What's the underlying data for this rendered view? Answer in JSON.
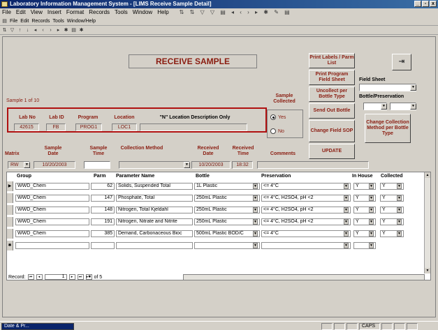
{
  "window": {
    "title": "Laboratory Information Management System - [LIMS Receive Sample Detail]",
    "min": "_",
    "max": "▫",
    "close": "x"
  },
  "menu": [
    "File",
    "Edit",
    "View",
    "Insert",
    "Format",
    "Records",
    "Tools",
    "Window",
    "Help"
  ],
  "menu2": [
    "File",
    "Edit",
    "Records",
    "Tools",
    "Window/Help"
  ],
  "form": {
    "title": "RECEIVE SAMPLE",
    "sample_count": "Sample 1 of 10",
    "labels": {
      "lab_no": "Lab No",
      "lab_id": "Lab ID",
      "program": "Program",
      "location": "Location",
      "loc_desc": "\"N\" Location Description Only",
      "sample_collected": "Sample Collected",
      "yes": "Yes",
      "no": "No",
      "matrix": "Matrix",
      "sample_date": "Sample Date",
      "sample_time": "Sample Time",
      "collection_method": "Collection Method",
      "received_date": "Received Date",
      "received_time": "Received Time",
      "comments": "Comments",
      "field_sheet": "Field Sheet",
      "bottle_pres": "Bottle/Preservation"
    },
    "values": {
      "lab_no": "42615",
      "lab_id": "FB",
      "program": "PROG1",
      "location": "LOC1",
      "loc_desc": "",
      "matrix": "RW",
      "sample_date": "10/20/2003",
      "sample_time": "",
      "collection_method": "",
      "received_date": "10/20/2003",
      "received_time": "18:32",
      "comments": "",
      "field_sheet": ""
    },
    "buttons": {
      "print_labels": "Print Labels / Parm List",
      "print_program": "Print Program Field Sheet",
      "uncollect": "Uncollect per Bottle Type",
      "send_out": "Send Out Bottle",
      "change_sop": "Change Field SOP",
      "update": "UPDATE",
      "change_collection": "Change Collection Method per Bottle Type",
      "exit_icon": "exit-door-icon"
    }
  },
  "grid": {
    "headers": {
      "group": "Group",
      "parm": "Parm",
      "parameter_name": "Parameter Name",
      "bottle": "Bottle",
      "preservation": "Preservation",
      "in_house": "In House",
      "collected": "Collected"
    },
    "rows": [
      {
        "group": "WWD_Chem",
        "parm": "62",
        "name": "Solids, Suspended Total",
        "bottle": "1L Plastic",
        "pres": "<= 4°C",
        "in_house": "Y",
        "collected": "Y"
      },
      {
        "group": "WWD_Chem",
        "parm": "147",
        "name": "Phosphate, Total",
        "bottle": "250mL Plastic",
        "pres": "<= 4°C, H2SO4, pH <2",
        "in_house": "Y",
        "collected": "Y"
      },
      {
        "group": "WWD_Chem",
        "parm": "148",
        "name": "Nitrogen, Total Kjeldahl",
        "bottle": "250mL Plastic",
        "pres": "<= 4°C, H2SO4, pH <2",
        "in_house": "Y",
        "collected": "Y"
      },
      {
        "group": "WWD_Chem",
        "parm": "191",
        "name": "Nitrogen, Nitrate and Nitrite",
        "bottle": "250mL Plastic",
        "pres": "<= 4°C, H2SO4, pH <2",
        "in_house": "Y",
        "collected": "Y"
      },
      {
        "group": "WWD_Chem",
        "parm": "385",
        "name": "Demand, Carbonaceous Bioc",
        "bottle": "500mL Plastic BOD/C",
        "pres": "<= 4°C",
        "in_house": "Y",
        "collected": "Y"
      }
    ],
    "nav": {
      "record_label": "Record:",
      "current": "1",
      "total": "of 5"
    }
  },
  "statusbar": {
    "task": "Date & Pr...",
    "caps": "CAPS"
  }
}
